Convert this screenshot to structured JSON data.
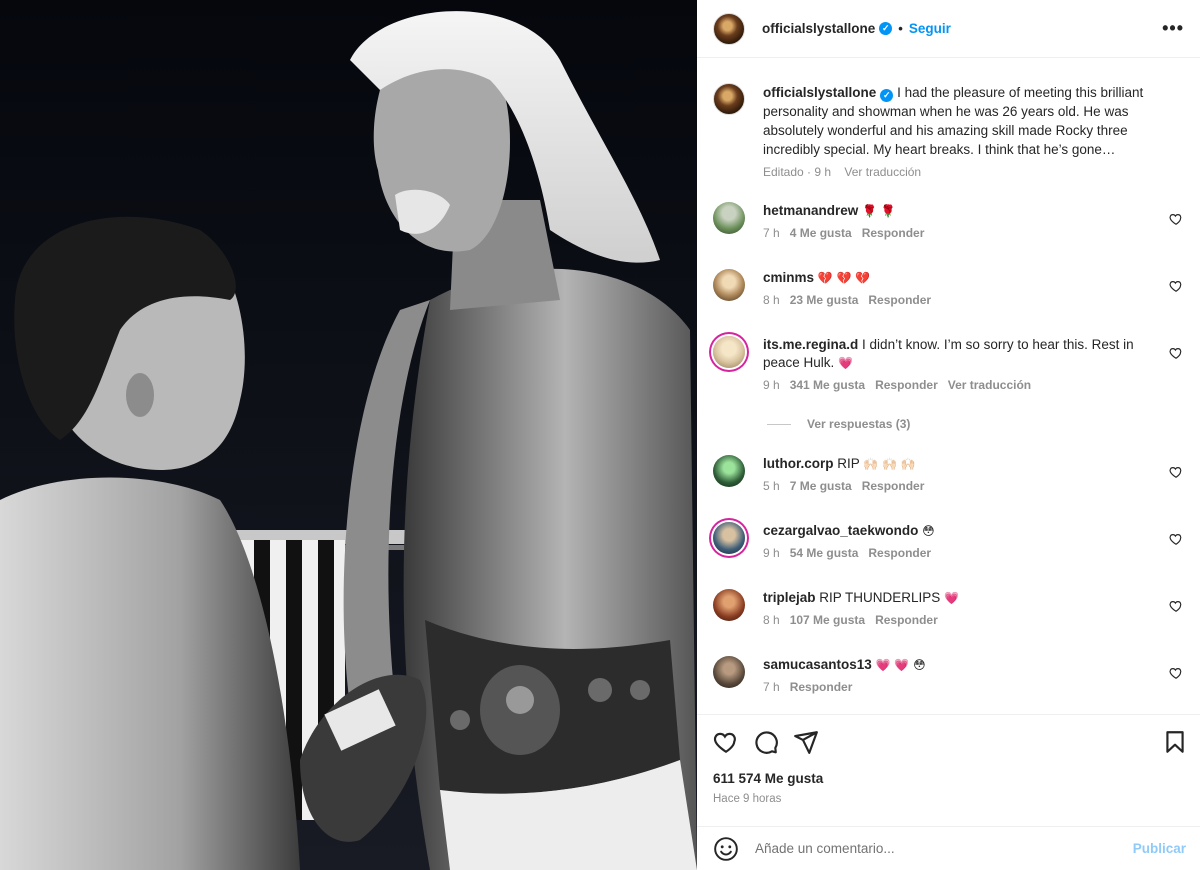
{
  "post": {
    "username": "officialslystallone",
    "follow_label": "Seguir",
    "more_label": "•••",
    "separator": "•",
    "caption_text": "I had the pleasure of meeting this brilliant personality and showman when he was 26 years old. He was absolutely wonderful and his amazing skill made Rocky three incredibly special. My heart breaks. I think that he’s gone…",
    "caption_time": "Editado · 9 h",
    "caption_translate": "Ver traducción"
  },
  "comments": [
    {
      "username": "hetmanandrew",
      "text": "",
      "emoji": "🌹 🌹",
      "time": "7 h",
      "likes": "4 Me gusta",
      "reply": "Responder",
      "translate": "",
      "avatar_color": "#6b8f5a"
    },
    {
      "username": "cminms",
      "text": "",
      "emoji": "💔 💔 💔",
      "time": "8 h",
      "likes": "23 Me gusta",
      "reply": "Responder",
      "translate": "",
      "avatar_color": "#b08a5c"
    },
    {
      "username": "its.me.regina.d",
      "text": "I didn’t know. I’m so sorry to hear this. Rest in peace Hulk.",
      "emoji": "💗",
      "time": "9 h",
      "likes": "341 Me gusta",
      "reply": "Responder",
      "translate": "Ver traducción",
      "avatar_color": "#d9c4a0"
    },
    {
      "username": "luthor.corp",
      "text": "RIP",
      "emoji": "🙌🏻 🙌🏻 🙌🏻",
      "time": "5 h",
      "likes": "7 Me gusta",
      "reply": "Responder",
      "translate": "",
      "avatar_color": "#2f5e38"
    },
    {
      "username": "cezargalvao_taekwondo",
      "text": "",
      "emoji": "😳",
      "time": "9 h",
      "likes": "54 Me gusta",
      "reply": "Responder",
      "translate": "",
      "avatar_color": "#3e5e78"
    },
    {
      "username": "triplejab",
      "text": "RIP THUNDERLIPS",
      "emoji": "💗",
      "time": "8 h",
      "likes": "107 Me gusta",
      "reply": "Responder",
      "translate": "",
      "avatar_color": "#8a3d22"
    },
    {
      "username": "samucasantos13",
      "text": "",
      "emoji": "💗 💗 😳",
      "time": "7 h",
      "likes": "",
      "reply": "Responder",
      "translate": "",
      "avatar_color": "#5a4a3c"
    }
  ],
  "view_replies": "Ver respuestas (3)",
  "footer": {
    "likes": "611 574 Me gusta",
    "time_ago": "Hace 9 horas",
    "add_comment_placeholder": "Añade un comentario...",
    "post_label": "Publicar"
  },
  "colors": {
    "accent": "#0095f6",
    "post_disabled": "#8fcaf9",
    "muted": "#8e8e8e",
    "heart": "#ed4956"
  },
  "icons": [
    "more-icon",
    "verified-icon",
    "heart-icon",
    "comment-icon",
    "share-icon",
    "bookmark-icon",
    "emoji-icon"
  ]
}
